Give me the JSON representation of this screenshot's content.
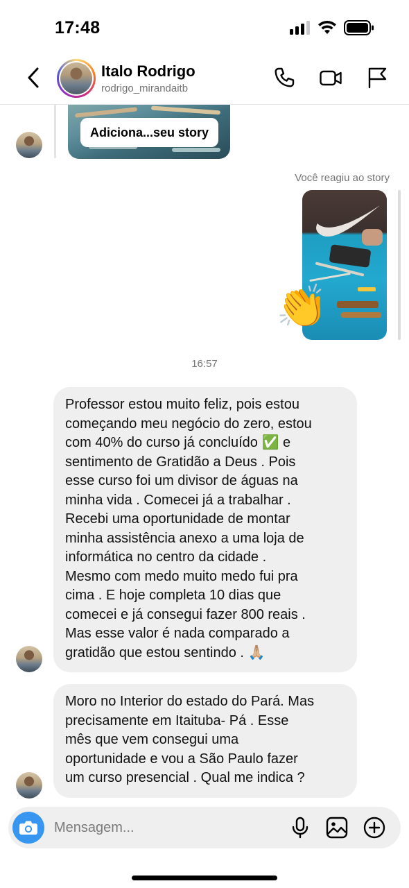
{
  "status_bar": {
    "time": "17:48"
  },
  "header": {
    "contact_name": "Italo Rodrigo",
    "contact_handle": "rodrigo_mirandaitb",
    "icons": [
      "back-chevron-icon",
      "phone-icon",
      "video-camera-icon",
      "flag-icon"
    ]
  },
  "story_reply": {
    "caption": "Adiciona...seu story"
  },
  "reaction": {
    "label": "Você reagiu ao story",
    "emoji": "👏"
  },
  "timestamp": "16:57",
  "messages": [
    {
      "text": "Professor estou muito feliz, pois estou\ncomeçando meu negócio do zero, estou\ncom 40% do curso já concluído ✅ e\nsentimento de Gratidão a Deus . Pois\nesse curso foi um divisor de águas na\nminha vida . Comecei já a trabalhar .\nRecebi uma oportunidade de montar\nminha assistência anexo a uma loja de\ninformática no centro da cidade .\nMesmo com medo muito medo fui pra\ncima . E hoje completa 10 dias que\ncomecei e já consegui fazer 800 reais .\nMas esse valor é nada comparado a\ngratidão que estou sentindo . 🙏🏼"
    },
    {
      "text": "Moro no Interior do estado do Pará. Mas\nprecisamente em Itaituba- Pá . Esse\nmês que vem consegui uma\noportunidade e vou a São Paulo fazer\num curso presencial .  Qual me indica ?"
    }
  ],
  "composer": {
    "placeholder": "Mensagem...",
    "icons": [
      "camera-icon",
      "microphone-icon",
      "gallery-icon",
      "plus-circle-icon"
    ],
    "accent_color": "#3797f0"
  },
  "colors": {
    "bubble_bg": "#efefef",
    "secondary_text": "#737373"
  }
}
